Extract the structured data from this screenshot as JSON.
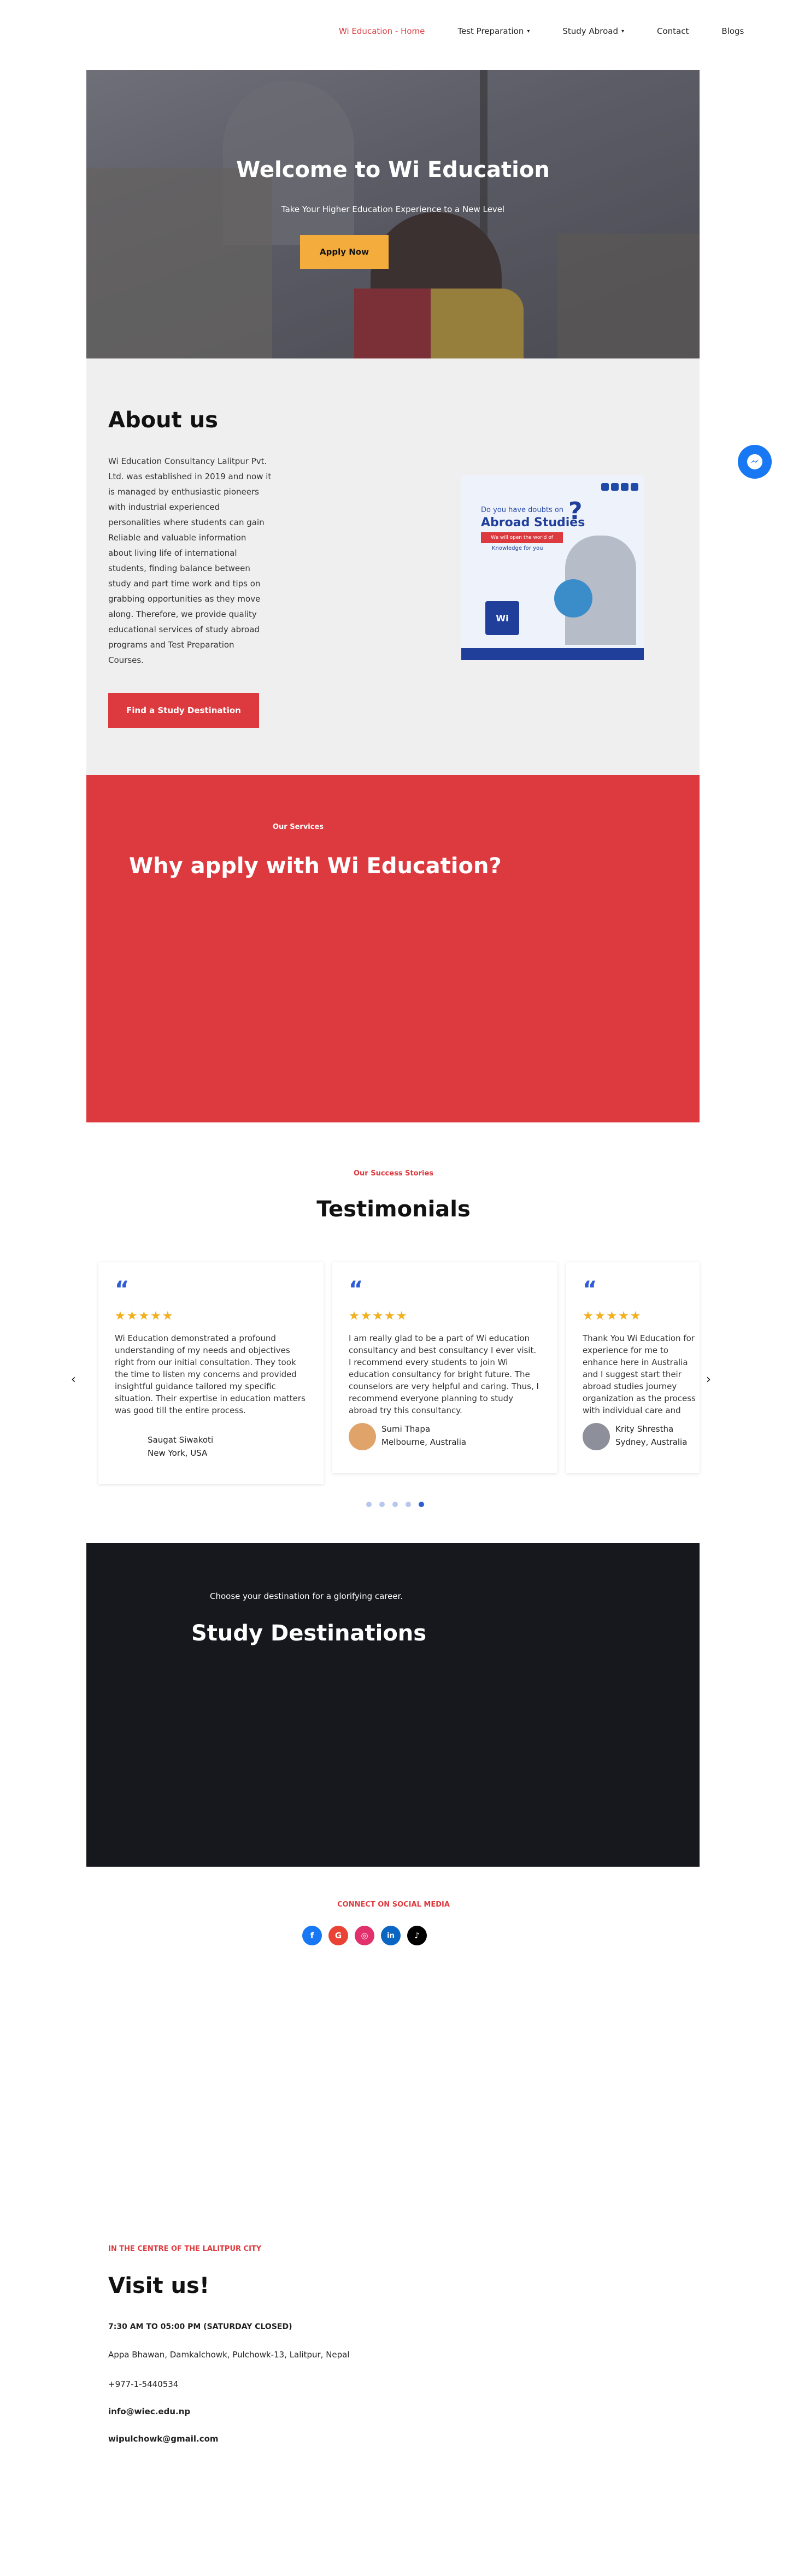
{
  "nav": {
    "items": [
      {
        "label": "Wi Education - Home",
        "dropdown": false,
        "active": true
      },
      {
        "label": "Test Preparation",
        "dropdown": true,
        "active": false
      },
      {
        "label": "Study Abroad",
        "dropdown": true,
        "active": false
      },
      {
        "label": "Contact",
        "dropdown": false,
        "active": false
      },
      {
        "label": "Blogs",
        "dropdown": false,
        "active": false
      }
    ]
  },
  "hero": {
    "title": "Welcome to Wi Education",
    "subtitle": "Take Your Higher Education Experience to a New Level",
    "button": "Apply Now"
  },
  "about": {
    "title": "About us",
    "paragraph": "Wi Education Consultancy Lalitpur Pvt. Ltd. was established in 2019 and now it is managed by enthusiastic pioneers with industrial experienced personalities where students can gain Reliable and valuable information about living life of international students, finding balance between study and part time work and tips on grabbing opportunities as they move along. Therefore, we provide quality educational services of study abroad programs and Test Preparation Courses.",
    "button": "Find a Study Destination",
    "poster": {
      "line1": "Do you have doubts on",
      "line2": "Abroad Studies",
      "qmark": "?",
      "banner": "We will open the world of",
      "line3": "Knowledge for you",
      "logo": "Wi"
    }
  },
  "services": {
    "eyebrow": "Our Services",
    "title": "Why apply with Wi Education?"
  },
  "testimonials": {
    "eyebrow": "Our Success Stories",
    "title": "Testimonials",
    "prev_icon": "‹",
    "next_icon": "›",
    "quote_mark": "“",
    "stars": "★★★★★",
    "items": [
      {
        "text": "Wi Education demonstrated a profound understanding of my needs and objectives right from our initial consultation. They took the time to listen my concerns and provided insightful guidance tailored my specific situation. Their expertise in education matters was good till the entire process.",
        "name": "Saugat Siwakoti",
        "location": "New York, USA"
      },
      {
        "text": "I am really glad to be a part of Wi education consultancy and best consultancy I ever visit. I recommend every students to join Wi education consultancy for bright future. The counselors are very helpful and caring. Thus, I recommend everyone planning to study abroad try this consultancy.",
        "name": "Sumi Thapa",
        "location": "Melbourne, Australia"
      },
      {
        "text": "Thank You Wi Education for experience for me to enhance here in Australia and I suggest start their abroad studies journey organization as the process with individual care and support teachers and counselors are",
        "name": "Krity Shrestha",
        "location": "Sydney, Australia"
      }
    ],
    "dots": 5,
    "active_dot": 4
  },
  "destinations": {
    "subtitle": "Choose your destination for a glorifying career.",
    "title": "Study Destinations"
  },
  "social": {
    "label": "CONNECT ON SOCIAL MEDIA",
    "icons": [
      {
        "name": "facebook-icon",
        "glyph": "f",
        "color": "#1877f2"
      },
      {
        "name": "google-icon",
        "glyph": "G",
        "color": "#ea4335"
      },
      {
        "name": "instagram-icon",
        "glyph": "◎",
        "color": "#e1306c"
      },
      {
        "name": "linkedin-icon",
        "glyph": "in",
        "color": "#0a66c2"
      },
      {
        "name": "tiktok-icon",
        "glyph": "♪",
        "color": "#000000"
      }
    ]
  },
  "visit": {
    "eyebrow": "IN THE CENTRE OF THE LALITPUR CITY",
    "title": "Visit us!",
    "hours": "7:30 AM TO 05:00 PM (SATURDAY CLOSED)",
    "address": "Appa Bhawan, Damkalchowk, Pulchowk-13, Lalitpur, Nepal",
    "phone": "+977-1-5440534",
    "email1": "info@wiec.edu.np",
    "email2": "wipulchowk@gmail.com"
  },
  "colors": {
    "accent": "#dc3a3f",
    "cta": "#f4ad3c",
    "dark": "#16181d",
    "star": "#f2b01e",
    "quote": "#2f5bd6",
    "messenger": "#1877f2"
  }
}
